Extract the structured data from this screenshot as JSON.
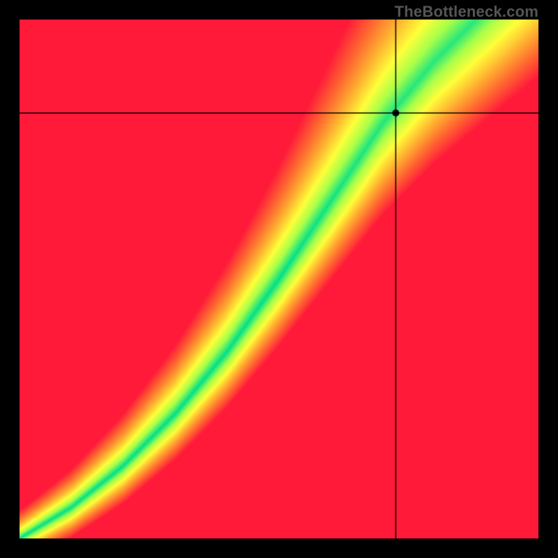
{
  "watermark": "TheBottleneck.com",
  "chart_data": {
    "type": "heatmap",
    "title": "",
    "xlabel": "",
    "ylabel": "",
    "xlim": [
      0,
      1
    ],
    "ylim": [
      0,
      1
    ],
    "grid": false,
    "marker": {
      "x": 0.725,
      "y": 0.82,
      "kind": "dot"
    },
    "crosshair": {
      "x": 0.725,
      "y": 0.82
    },
    "ideal_band": {
      "description": "green band where GPU/CPU pairing is balanced; curve steepens toward bottom-left",
      "control_points": [
        {
          "x": 0.0,
          "y": 0.0
        },
        {
          "x": 0.1,
          "y": 0.06
        },
        {
          "x": 0.2,
          "y": 0.14
        },
        {
          "x": 0.3,
          "y": 0.24
        },
        {
          "x": 0.4,
          "y": 0.36
        },
        {
          "x": 0.5,
          "y": 0.5
        },
        {
          "x": 0.6,
          "y": 0.65
        },
        {
          "x": 0.7,
          "y": 0.8
        },
        {
          "x": 0.8,
          "y": 0.92
        },
        {
          "x": 0.9,
          "y": 1.02
        },
        {
          "x": 1.0,
          "y": 1.12
        }
      ],
      "half_width_frac": 0.06
    },
    "colormap": {
      "stops": [
        {
          "t": 0.0,
          "color": "#00e08a"
        },
        {
          "t": 0.18,
          "color": "#a8ff4a"
        },
        {
          "t": 0.35,
          "color": "#ffff3a"
        },
        {
          "t": 0.55,
          "color": "#ffb030"
        },
        {
          "t": 0.75,
          "color": "#ff6a30"
        },
        {
          "t": 1.0,
          "color": "#ff1a3a"
        }
      ]
    },
    "corner_gradients": {
      "description": "yellow biased toward top-right; red in top-left and bottom-right; darker red bottom-right extreme"
    }
  }
}
